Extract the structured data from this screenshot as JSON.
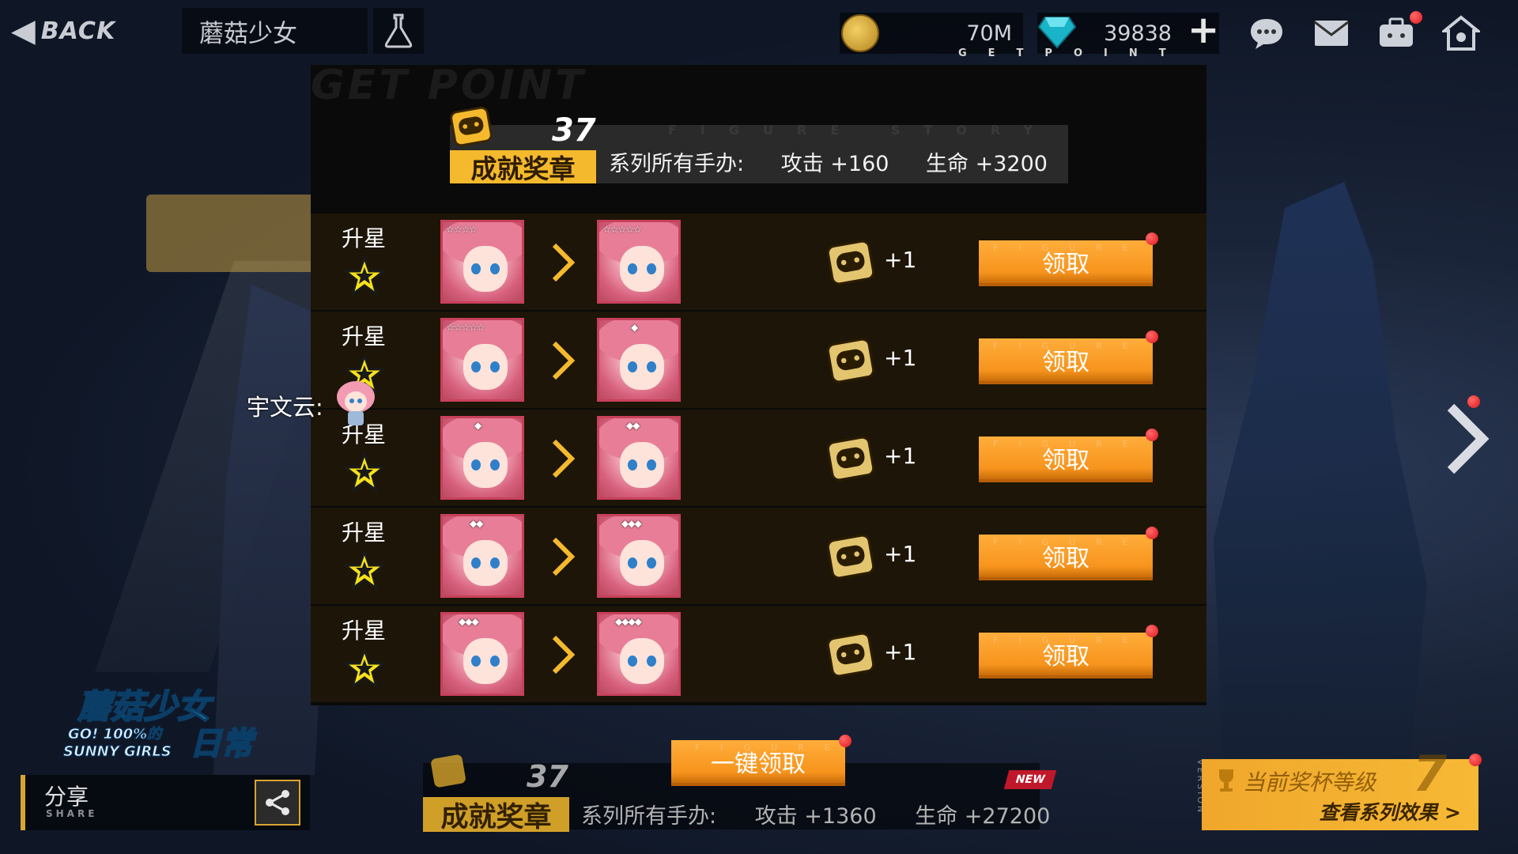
{
  "topbar": {
    "back_label": "BACK",
    "series_name": "蘑菇少女",
    "gold_amount": "70M",
    "gem_amount": "39838",
    "getpoint_label": "GETPOINT"
  },
  "panel": {
    "watermark": "GET POINT",
    "medal": {
      "count": "37",
      "label": "成就奖章",
      "watermark": "FIGURE STORY",
      "bonus_prefix": "系列所有手办:",
      "bonus_attack": "攻击 +160",
      "bonus_hp": "生命 +3200"
    },
    "rows": [
      {
        "title": "升星",
        "from_rank": "☆☆☆☆",
        "to_rank": "☆☆☆☆☆",
        "reward": "+1",
        "button": "领取"
      },
      {
        "title": "升星",
        "from_rank": "☆☆☆☆☆",
        "to_rank": "◆",
        "reward": "+1",
        "button": "领取"
      },
      {
        "title": "升星",
        "from_rank": "◆",
        "to_rank": "◆◆",
        "reward": "+1",
        "button": "领取"
      },
      {
        "title": "升星",
        "from_rank": "◆◆",
        "to_rank": "◆◆◆",
        "reward": "+1",
        "button": "领取"
      },
      {
        "title": "升星",
        "from_rank": "◆◆◆",
        "to_rank": "◆◆◆◆",
        "reward": "+1",
        "button": "领取"
      }
    ],
    "button_watermark": "FIGURE",
    "claim_all": "一键领取"
  },
  "chat": {
    "speaker": "宇文云:"
  },
  "bottom": {
    "medal_count": "37",
    "medal_label": "成就奖章",
    "bonus_prefix": "系列所有手办:",
    "bonus_attack": "攻击 +1360",
    "bonus_hp": "生命 +27200",
    "new_badge": "NEW"
  },
  "share": {
    "label": "分享",
    "sub": "SHARE"
  },
  "logo": {
    "line1": "蘑菇少女",
    "line2": "GO! 100%的",
    "line3": "SUNNY GIRLS",
    "line4": "日常"
  },
  "trophy": {
    "title": "当前奖杯等级",
    "level": "7",
    "link": "查看系列效果 >",
    "version": "VERSION"
  },
  "colors": {
    "accent_orange": "#f7941d",
    "medal_gold": "#f4b92d",
    "notify_red": "#e0151b"
  }
}
